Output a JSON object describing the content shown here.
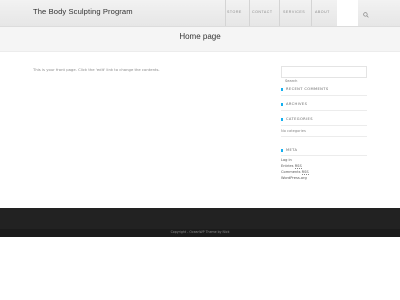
{
  "header": {
    "site_title": "The Body Sculpting Program",
    "nav": [
      "STORE",
      "CONTACT",
      "SERVICES",
      "ABOUT"
    ]
  },
  "page": {
    "title": "Home page",
    "content": "This is your front page. Click the 'edit' link to change the contents."
  },
  "sidebar": {
    "search_placeholder": "Search",
    "recent_comments": "RECENT COMMENTS",
    "archives": "ARCHIVES",
    "categories": "CATEGORIES",
    "no_categories": "No categories",
    "meta": "META",
    "meta_links": {
      "login": "Log in",
      "entries_prefix": "Entries",
      "entries_abbr": "RSS",
      "comments_prefix": "Comments",
      "comments_abbr": "RSS",
      "wordpress": "WordPress.org"
    }
  },
  "footer": {
    "copyright": "Copyright - OceanWP Theme by Nick"
  },
  "colors": {
    "accent": "#13aff0",
    "footer_bg": "#222222"
  }
}
